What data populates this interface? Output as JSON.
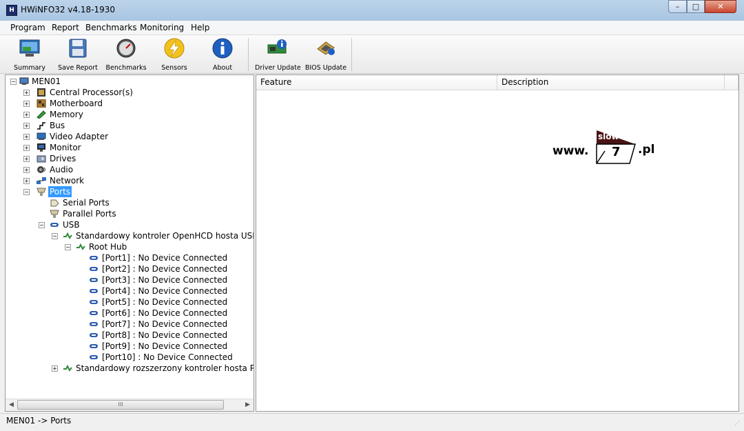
{
  "window": {
    "title": "HWiNFO32 v4.18-1930",
    "minimize": "–",
    "maximize": "□",
    "close": "✕"
  },
  "menu": [
    "Program",
    "Report",
    "Benchmarks",
    "Monitoring",
    "Help"
  ],
  "toolbar": {
    "summary": "Summary",
    "save_report": "Save Report",
    "benchmarks": "Benchmarks",
    "sensors": "Sensors",
    "about": "About",
    "driver_update": "Driver Update",
    "bios_update": "BIOS Update"
  },
  "tree": {
    "root": "MEN01",
    "items": [
      {
        "label": "Central Processor(s)",
        "icon": "cpu-icon"
      },
      {
        "label": "Motherboard",
        "icon": "motherboard-icon"
      },
      {
        "label": "Memory",
        "icon": "memory-icon"
      },
      {
        "label": "Bus",
        "icon": "bus-icon"
      },
      {
        "label": "Video Adapter",
        "icon": "video-adapter-icon"
      },
      {
        "label": "Monitor",
        "icon": "monitor-icon"
      },
      {
        "label": "Drives",
        "icon": "drives-icon"
      },
      {
        "label": "Audio",
        "icon": "audio-icon"
      },
      {
        "label": "Network",
        "icon": "network-icon"
      },
      {
        "label": "Ports",
        "icon": "ports-icon"
      }
    ],
    "ports_children": [
      "Serial Ports",
      "Parallel Ports",
      "USB"
    ],
    "usb_controller": "Standardowy kontroler OpenHCD hosta USB",
    "root_hub": "Root Hub",
    "usb_ports": [
      "[Port1] : No Device Connected",
      "[Port2] : No Device Connected",
      "[Port3] : No Device Connected",
      "[Port4] : No Device Connected",
      "[Port5] : No Device Connected",
      "[Port6] : No Device Connected",
      "[Port7] : No Device Connected",
      "[Port8] : No Device Connected",
      "[Port9] : No Device Connected",
      "[Port10] : No Device Connected"
    ],
    "usb_controller_2": "Standardowy rozszerzony kontroler hosta PCI d"
  },
  "details": {
    "col_feature": "Feature",
    "col_description": "Description"
  },
  "watermark": {
    "prefix": "www.",
    "badge_top": "slow",
    "badge_num": "7",
    "suffix": ".pl"
  },
  "status": "MEN01 -> Ports",
  "colors": {
    "selection": "#3399ff",
    "titlebar": "#b5cde6"
  }
}
